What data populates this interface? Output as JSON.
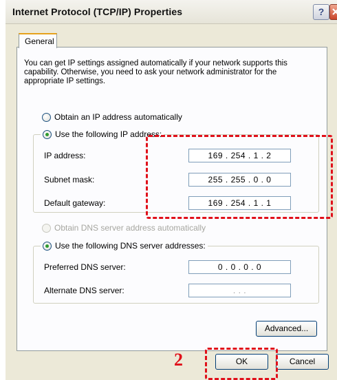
{
  "window": {
    "title": "Internet Protocol (TCP/IP) Properties",
    "help_label": "?"
  },
  "tabs": [
    {
      "label": "General"
    }
  ],
  "description": "You can get IP settings assigned automatically if your network supports this capability. Otherwise, you need to ask your network administrator for the appropriate IP settings.",
  "ip_section": {
    "auto_option": {
      "label": "Obtain an IP address automatically",
      "selected": false
    },
    "manual_option": {
      "label": "Use the following IP address:",
      "selected": true
    },
    "fields": [
      {
        "label": "IP address:",
        "value": "169 . 254 .  1  .  2"
      },
      {
        "label": "Subnet mask:",
        "value": "255 . 255 .  0  .  0"
      },
      {
        "label": "Default gateway:",
        "value": "169 . 254 .  1  .  1"
      }
    ]
  },
  "dns_section": {
    "auto_option": {
      "label": "Obtain DNS server address automatically",
      "selected": false,
      "disabled": true
    },
    "manual_option": {
      "label": "Use the following DNS server addresses:",
      "selected": true
    },
    "fields": [
      {
        "label": "Preferred DNS server:",
        "value": "0  .  0  .  0  .  0"
      },
      {
        "label": "Alternate DNS server:",
        "value": ".        .        ."
      }
    ]
  },
  "buttons": {
    "advanced": "Advanced...",
    "ok": "OK",
    "cancel": "Cancel"
  },
  "annotation": {
    "step_number": "2",
    "color": "#e0101a"
  },
  "colors": {
    "window_bg": "#ece9d8",
    "panel_bg": "#fcfcfe",
    "radio_dot": "#2f9a2f"
  }
}
